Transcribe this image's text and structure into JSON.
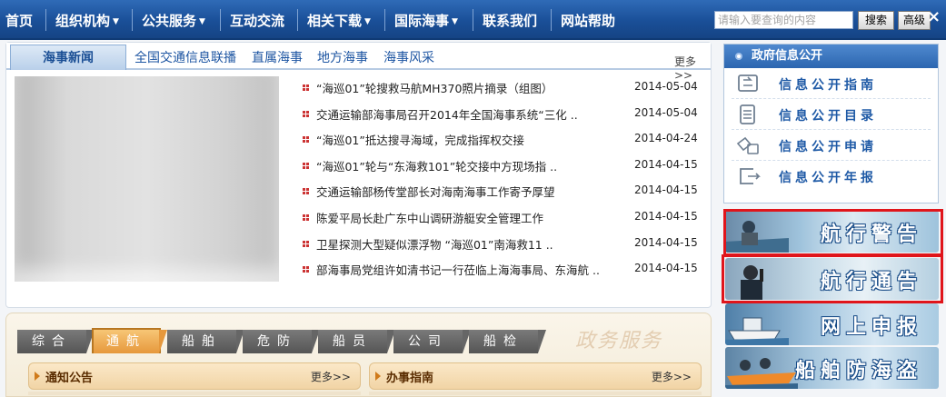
{
  "nav": {
    "items": [
      "首页",
      "组织机构",
      "公共服务",
      "互动交流",
      "相关下载",
      "国际海事",
      "联系我们",
      "网站帮助"
    ],
    "search_placeholder": "请输入要查询的内容",
    "search_button": "搜索",
    "advanced_button": "高级",
    "close_symbol": "×"
  },
  "news": {
    "active_tab": "海事新闻",
    "tabs": [
      "全国交通信息联播",
      "直属海事",
      "地方海事",
      "海事风采"
    ],
    "more": "更多>>",
    "items": [
      {
        "title": "“海巡01”轮搜救马航MH370照片摘录（组图）",
        "date": "2014-05-04"
      },
      {
        "title": "交通运输部海事局召开2014年全国海事系统“三化 ..",
        "date": "2014-05-04"
      },
      {
        "title": "“海巡01”抵达搜寻海域，完成指挥权交接",
        "date": "2014-04-24"
      },
      {
        "title": "“海巡01”轮与“东海救101”轮交接中方现场指 ..",
        "date": "2014-04-15"
      },
      {
        "title": "交通运输部杨传堂部长对海南海事工作寄予厚望",
        "date": "2014-04-15"
      },
      {
        "title": "陈爱平局长赴广东中山调研游艇安全管理工作",
        "date": "2014-04-15"
      },
      {
        "title": "卫星探测大型疑似漂浮物 “海巡01”南海救11 ..",
        "date": "2014-04-15"
      },
      {
        "title": "部海事局党组许如清书记一行莅临上海海事局、东海航 ..",
        "date": "2014-04-15"
      }
    ]
  },
  "service": {
    "tabs": [
      "综合",
      "通航",
      "船舶",
      "危防",
      "船员",
      "公司",
      "船检"
    ],
    "active_tab": "通航",
    "watermark": "政务服务",
    "panels": [
      {
        "title": "通知公告",
        "more": "更多>>"
      },
      {
        "title": "办事指南",
        "more": "更多>>"
      }
    ]
  },
  "gov_info": {
    "header": "政府信息公开",
    "items": [
      "信息公开指南",
      "信息公开目录",
      "信息公开申请",
      "信息公开年报"
    ],
    "icons": [
      "guide-icon",
      "catalog-icon",
      "apply-icon",
      "report-icon"
    ]
  },
  "banners": [
    {
      "text": "航行警告",
      "highlighted": true
    },
    {
      "text": "航行通告",
      "highlighted": true
    },
    {
      "text": "网上申报",
      "highlighted": false
    },
    {
      "text": "船舶防海盗",
      "highlighted": false
    }
  ],
  "colors": {
    "nav_bg": "#1a4f98",
    "accent_blue": "#1d55a2",
    "active_service_tab": "#e6983c",
    "highlight_frame": "#e0151b",
    "bullet": "#cc3333"
  }
}
